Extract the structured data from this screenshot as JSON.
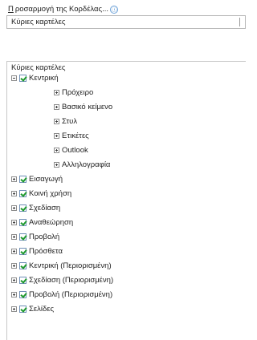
{
  "header": {
    "underline_char": "Π",
    "rest": "ροσαρμογή της Κορδέλας...",
    "info_icon": "ⓘ"
  },
  "dropdown": {
    "value": "Κύριες καρτέλες"
  },
  "tree": {
    "title": "Κύριες καρτέλες",
    "items": [
      {
        "label": "Κεντρική",
        "level": 0,
        "expander": "minus",
        "checked": true
      },
      {
        "label": "Πρόχειρο",
        "level": 1,
        "expander": "plus",
        "checked": false
      },
      {
        "label": "Βασικό κείμενο",
        "level": 1,
        "expander": "plus",
        "checked": false
      },
      {
        "label": "Στυλ",
        "level": 1,
        "expander": "plus",
        "checked": false
      },
      {
        "label": "Ετικέτες",
        "level": 1,
        "expander": "plus",
        "checked": false
      },
      {
        "label": "Outlook",
        "level": 1,
        "expander": "plus",
        "checked": false
      },
      {
        "label": "Αλληλογραφία",
        "level": 1,
        "expander": "plus",
        "checked": false
      },
      {
        "label": "Εισαγωγή",
        "level": 0,
        "expander": "plus",
        "checked": true
      },
      {
        "label": "Κοινή χρήση",
        "level": 0,
        "expander": "plus",
        "checked": true
      },
      {
        "label": "Σχεδίαση",
        "level": 0,
        "expander": "plus",
        "checked": true
      },
      {
        "label": "Αναθεώρηση",
        "level": 0,
        "expander": "plus",
        "checked": true
      },
      {
        "label": "Προβολή",
        "level": 0,
        "expander": "plus",
        "checked": true
      },
      {
        "label": "Πρόσθετα",
        "level": 0,
        "expander": "plus",
        "checked": true
      },
      {
        "label": "Κεντρική (Περιορισμένη)",
        "level": 0,
        "expander": "plus",
        "checked": true
      },
      {
        "label": "Σχεδίαση (Περιορισμένη)",
        "level": 0,
        "expander": "plus",
        "checked": true
      },
      {
        "label": "Προβολή (Περιορισμένη)",
        "level": 0,
        "expander": "plus",
        "checked": true
      },
      {
        "label": "Σελίδες",
        "level": 0,
        "expander": "plus",
        "checked": true
      }
    ]
  }
}
